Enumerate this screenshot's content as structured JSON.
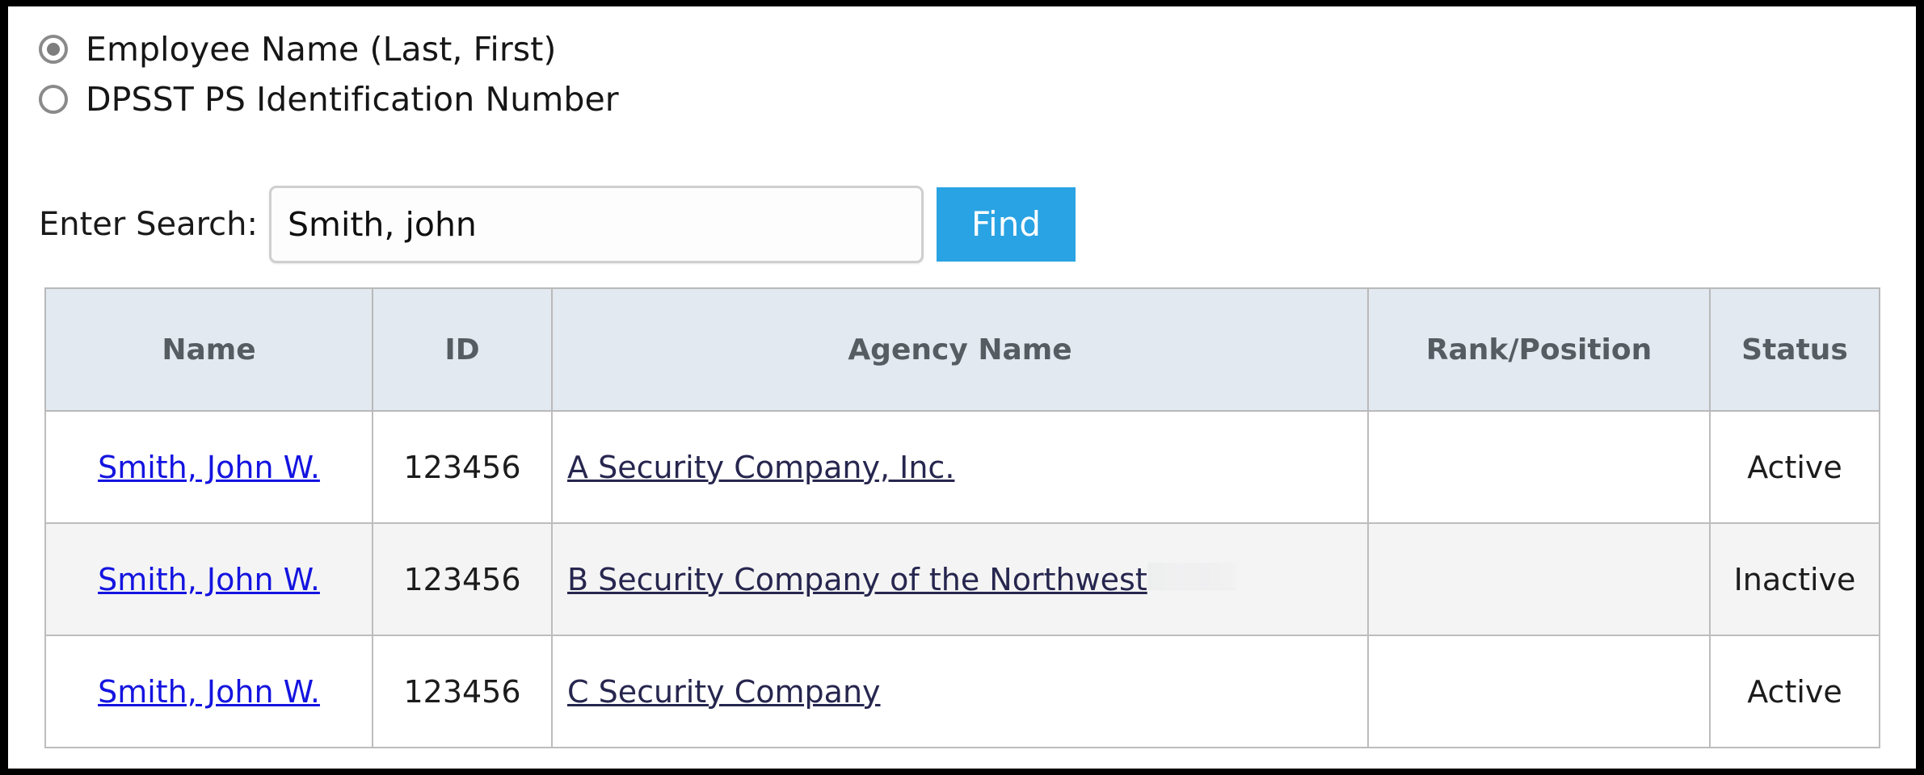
{
  "search_mode": {
    "options": [
      {
        "label": "Employee Name (Last, First)",
        "selected": true
      },
      {
        "label": "DPSST PS Identification Number",
        "selected": false
      }
    ]
  },
  "search": {
    "label": "Enter Search:",
    "value": "Smith, john",
    "placeholder": "",
    "find_label": "Find"
  },
  "results": {
    "columns": [
      "Name",
      "ID",
      "Agency Name",
      "Rank/Position",
      "Status"
    ],
    "rows": [
      {
        "name": "Smith, John W.",
        "id": "123456",
        "agency": "A Security Company, Inc.",
        "rank": "",
        "status": "Active"
      },
      {
        "name": "Smith, John W.",
        "id": "123456",
        "agency": "B Security Company of the Northwest",
        "rank": "",
        "status": "Inactive"
      },
      {
        "name": "Smith, John W.",
        "id": "123456",
        "agency": "C Security Company",
        "rank": "",
        "status": "Active"
      }
    ]
  },
  "colors": {
    "find_button": "#29a3e3",
    "header_background": "#e2e9f0",
    "name_link": "#1414e0",
    "agency_link": "#26264f",
    "alt_row": "#f4f4f4"
  }
}
